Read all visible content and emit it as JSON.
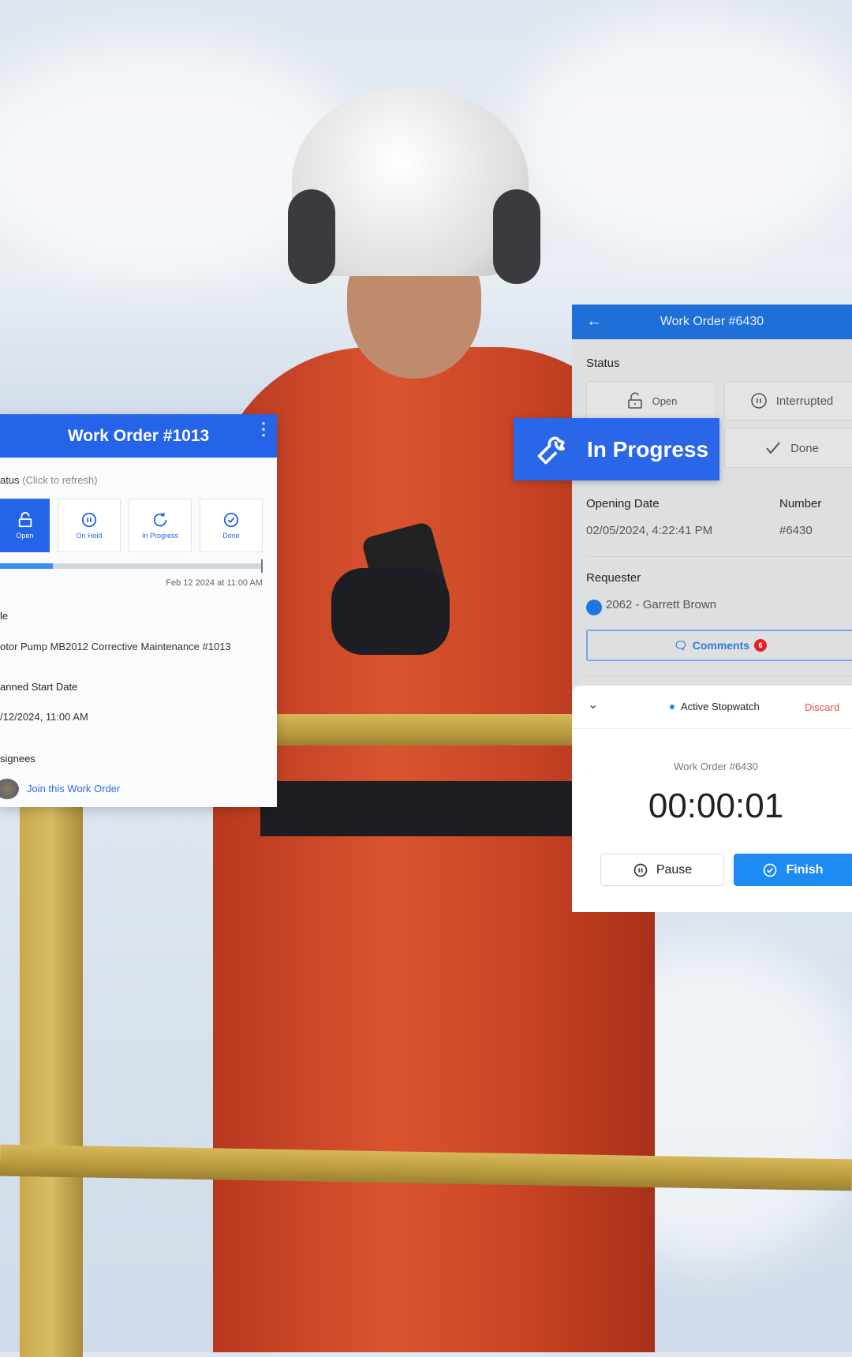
{
  "left_card": {
    "title": "Work Order #1013",
    "status_label": "atus",
    "status_hint": "(Click to refresh)",
    "status_buttons": [
      {
        "label": "Open",
        "icon": "unlock-icon",
        "active": true
      },
      {
        "label": "On Hold",
        "icon": "pause-circle-icon",
        "active": false
      },
      {
        "label": "In Progress",
        "icon": "refresh-icon",
        "active": false
      },
      {
        "label": "Done",
        "icon": "check-circle-icon",
        "active": false
      }
    ],
    "progress_fraction": 0.2,
    "progress_date": "Feb 12 2024 at 11:00 AM",
    "title_label": "le",
    "title_value": "otor Pump MB2012 Corrective Maintenance #1013",
    "start_label": "anned Start Date",
    "start_value": "/12/2024, 11:00 AM",
    "assignees_label": "signees",
    "join_link": "Join this Work Order",
    "accent": "#2563e8"
  },
  "right_panel": {
    "title": "Work Order #6430",
    "status_label": "Status",
    "buttons": {
      "open": "Open",
      "interrupted": "Interrupted",
      "done": "Done"
    },
    "in_progress": "In Progress",
    "opening_date_label": "Opening Date",
    "opening_date_value": "02/05/2024, 4:22:41 PM",
    "number_label": "Number",
    "number_value": "#6430",
    "requester_label": "Requester",
    "requester_value": "2062 - Garrett Brown",
    "comments": "Comments",
    "comments_badge": "6"
  },
  "stopwatch": {
    "title": "Active Stopwatch",
    "discard": "Discard",
    "work_order": "Work Order #6430",
    "time": "00:00:01",
    "pause": "Pause",
    "finish": "Finish",
    "finish_color": "#1c8cf4",
    "discard_color": "#f05050"
  }
}
